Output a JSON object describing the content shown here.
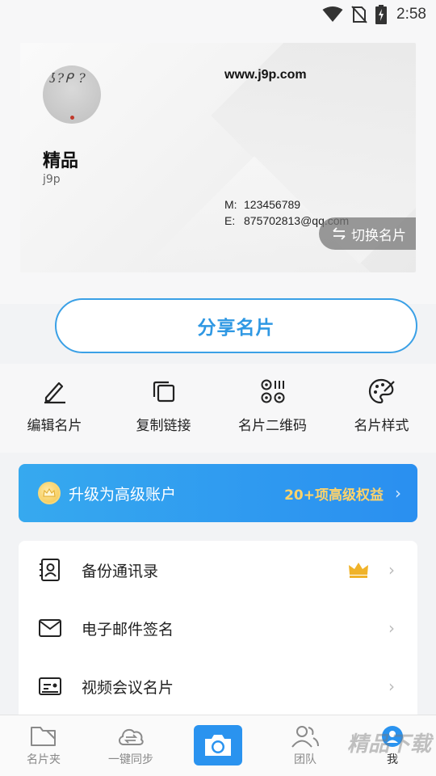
{
  "status_bar": {
    "time": "2:58",
    "icons": [
      "wifi-icon",
      "no-sim-icon",
      "battery-charging-icon"
    ]
  },
  "card": {
    "name": "精品",
    "company": "j9p",
    "website": "www.j9p.com",
    "mobile_label": "M:",
    "mobile": "123456789",
    "email_label": "E:",
    "email": "875702813@qq.com",
    "switch_label": "切换名片",
    "switch_icon": "swap-icon"
  },
  "share_label": "分享名片",
  "actions": [
    {
      "label": "编辑名片",
      "icon": "edit-pen-icon"
    },
    {
      "label": "复制链接",
      "icon": "copy-icon"
    },
    {
      "label": "名片二维码",
      "icon": "qr-code-icon"
    },
    {
      "label": "名片样式",
      "icon": "palette-icon"
    }
  ],
  "upgrade": {
    "title": "升级为高级账户",
    "benefit": "20+项高级权益",
    "coin_icon": "vip-coin-icon",
    "accent_color": "#ffd36a",
    "bg_color": "#2f9bef"
  },
  "list": [
    {
      "label": "备份通讯录",
      "icon": "contacts-backup-icon",
      "badge": "crown-icon"
    },
    {
      "label": "电子邮件签名",
      "icon": "mail-icon"
    },
    {
      "label": "视频会议名片",
      "icon": "video-card-icon"
    }
  ],
  "tabs": [
    {
      "label": "名片夹",
      "icon": "folder-icon"
    },
    {
      "label": "一键同步",
      "icon": "cloud-sync-icon"
    },
    {
      "label": "",
      "icon": "camera-icon"
    },
    {
      "label": "团队",
      "icon": "team-icon"
    },
    {
      "label": "我",
      "icon": "me-icon"
    }
  ],
  "watermark": "精品下载",
  "colors": {
    "primary": "#2f98e3",
    "page_bg": "#f2f3f5"
  }
}
